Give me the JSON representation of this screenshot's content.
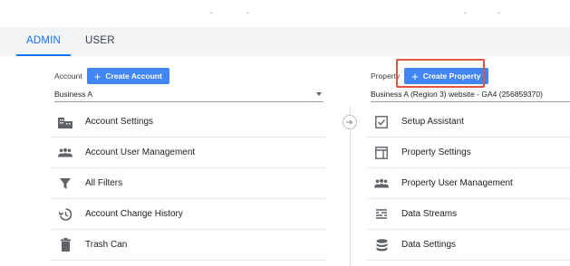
{
  "tabs": [
    {
      "label": "ADMIN"
    },
    {
      "label": "USER"
    }
  ],
  "account": {
    "label": "Account",
    "create_button": "Create Account",
    "selected": "Business A",
    "items": [
      {
        "label": "Account Settings",
        "icon": "building-icon"
      },
      {
        "label": "Account User Management",
        "icon": "people-icon"
      },
      {
        "label": "All Filters",
        "icon": "filter-icon"
      },
      {
        "label": "Account Change History",
        "icon": "history-icon"
      },
      {
        "label": "Trash Can",
        "icon": "trash-icon"
      }
    ]
  },
  "property": {
    "label": "Property",
    "create_button": "Create Property",
    "selected": "Business A (Region 3) website - GA4 (256859370)",
    "items": [
      {
        "label": "Setup Assistant",
        "icon": "checkbox-icon"
      },
      {
        "label": "Property Settings",
        "icon": "layout-icon"
      },
      {
        "label": "Property User Management",
        "icon": "people-icon"
      },
      {
        "label": "Data Streams",
        "icon": "streams-icon"
      },
      {
        "label": "Data Settings",
        "icon": "database-icon"
      }
    ]
  },
  "colors": {
    "accent": "#1a73e8",
    "button": "#4285f4",
    "highlight": "#e2553c"
  }
}
